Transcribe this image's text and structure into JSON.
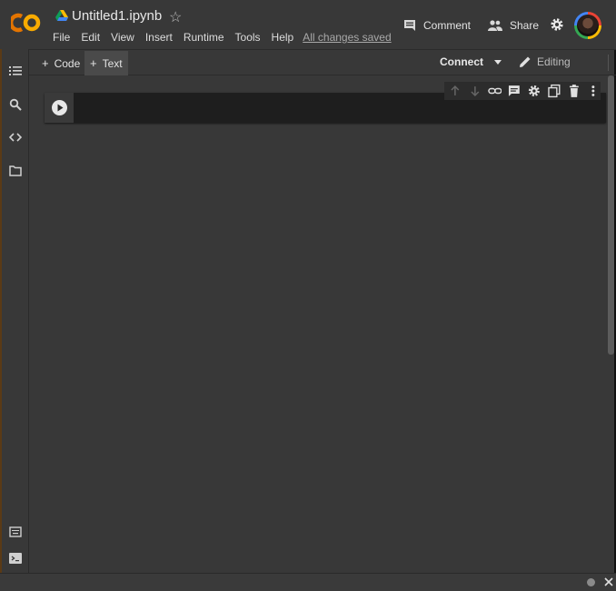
{
  "header": {
    "logo": "CO",
    "title": "Untitled1.ipynb",
    "menu": [
      "File",
      "Edit",
      "View",
      "Insert",
      "Runtime",
      "Tools",
      "Help"
    ],
    "save_status": "All changes saved",
    "comment_label": "Comment",
    "share_label": "Share"
  },
  "toolbar": {
    "add_code_label": "Code",
    "add_text_label": "Text",
    "connect_label": "Connect",
    "editing_label": "Editing"
  },
  "sidebar": {
    "icons": [
      "toc-icon",
      "search-icon",
      "code-snippets-icon",
      "folder-icon"
    ],
    "bottom_icons": [
      "command-palette-icon",
      "terminal-icon"
    ]
  },
  "cell_toolbar": {
    "icons": [
      "arrow-up-icon",
      "arrow-down-icon",
      "link-icon",
      "comment-icon",
      "settings-icon",
      "mirror-cell-icon",
      "delete-icon",
      "more-icon"
    ]
  },
  "colors": {
    "background": "#383838",
    "cell_background": "#1e1e1e",
    "logo_orange": "#f9ab00",
    "logo_dark_orange": "#e37400"
  }
}
